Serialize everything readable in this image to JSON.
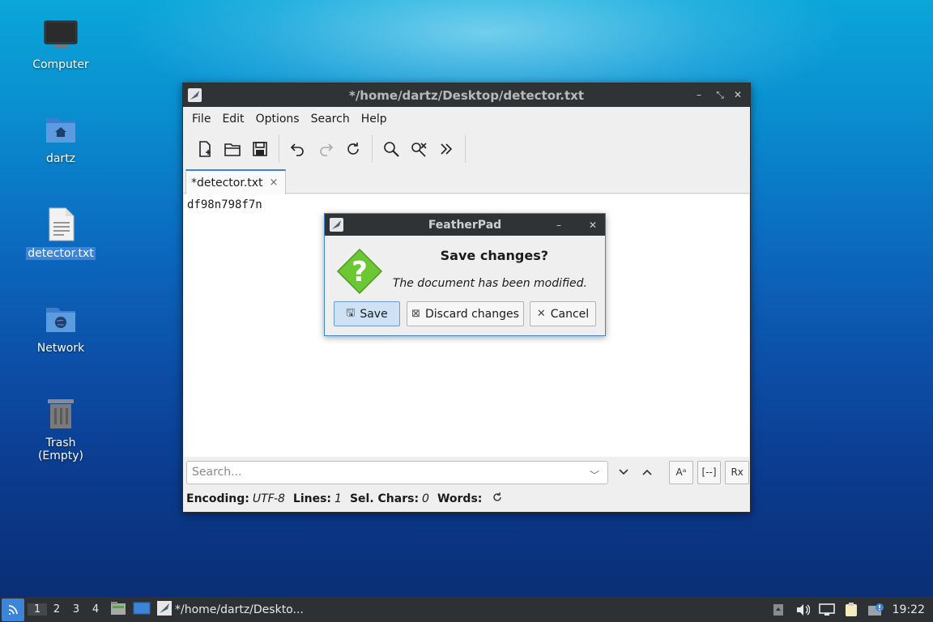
{
  "desktop": {
    "icons": [
      {
        "label": "Computer"
      },
      {
        "label": "dartz"
      },
      {
        "label": "detector.txt"
      },
      {
        "label": "Network"
      },
      {
        "label": "Trash (Empty)"
      }
    ]
  },
  "window": {
    "title": "*/home/dartz/Desktop/detector.txt",
    "menu": [
      "File",
      "Edit",
      "Options",
      "Search",
      "Help"
    ],
    "tab": {
      "label": "*detector.txt",
      "close": "×"
    },
    "content": "df98n798f7n",
    "search": {
      "placeholder": "Search..."
    },
    "search_options": [
      "Aᵃ",
      "[--]",
      "Rx"
    ],
    "status": {
      "encoding_label": "Encoding:",
      "encoding_value": "UTF-8",
      "lines_label": "Lines:",
      "lines_value": "1",
      "sel_label": "Sel. Chars:",
      "sel_value": "0",
      "words_label": "Words:"
    }
  },
  "dialog": {
    "title": "FeatherPad",
    "heading": "Save changes?",
    "message": "The document has been modified.",
    "buttons": {
      "save": "Save",
      "discard": "Discard changes",
      "cancel": "Cancel"
    }
  },
  "taskbar": {
    "workspaces": [
      "1",
      "2",
      "3",
      "4"
    ],
    "app_label": "*/home/dartz/Deskto...",
    "clock": "19:22"
  },
  "colors": {
    "accent": "#3b84d8",
    "titlebar": "#303336",
    "help_icon": "#6cc832"
  }
}
